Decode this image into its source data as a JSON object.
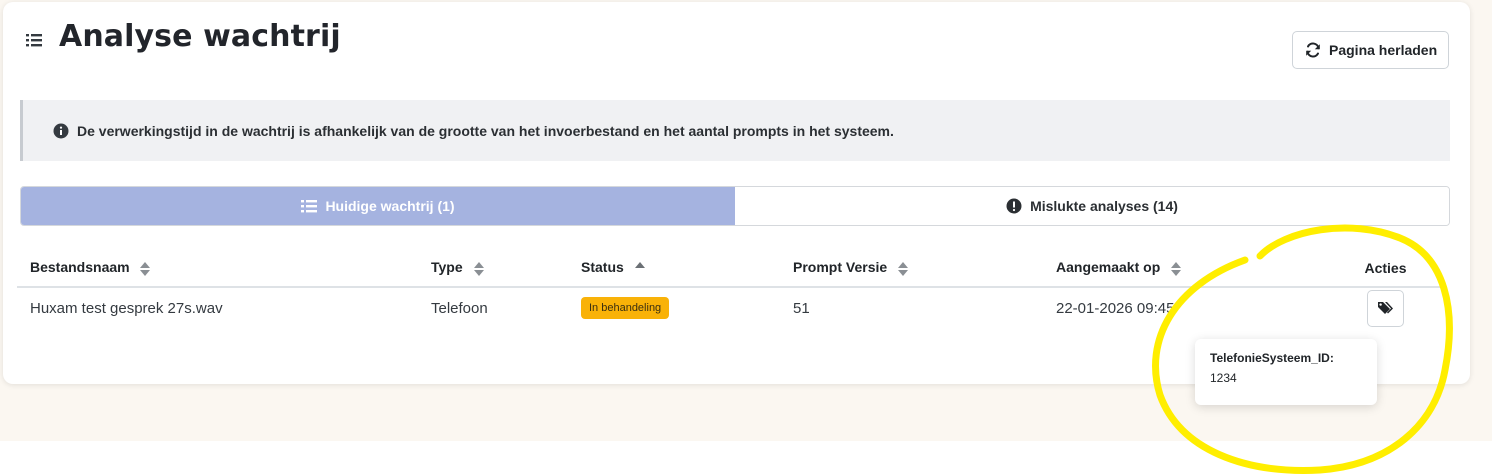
{
  "page": {
    "title": "Analyse wachtrij",
    "menu_icon": "list-icon",
    "reload_button": {
      "label": "Pagina herladen",
      "icon": "refresh-icon"
    }
  },
  "alert": {
    "icon": "info-circle-icon",
    "text": "De verwerkingstijd in de wachtrij is afhankelijk van de grootte van het invoerbestand en het aantal prompts in het systeem."
  },
  "tabs": [
    {
      "label": "Huidige wachtrij (1)",
      "icon": "list-icon",
      "active": true
    },
    {
      "label": "Mislukte analyses (14)",
      "icon": "exclamation-circle-icon",
      "active": false
    }
  ],
  "table": {
    "columns": [
      {
        "label": "Bestandsnaam",
        "sort": "both"
      },
      {
        "label": "Type",
        "sort": "both"
      },
      {
        "label": "Status",
        "sort": "asc"
      },
      {
        "label": "Prompt Versie",
        "sort": "both"
      },
      {
        "label": "Aangemaakt op",
        "sort": "both"
      },
      {
        "label": "Acties",
        "sort": "none"
      }
    ],
    "rows": [
      {
        "filename": "Huxam test gesprek 27s.wav",
        "type": "Telefoon",
        "status": "In behandeling",
        "prompt_version": "51",
        "created": "22-01-2026 09:45",
        "action_icon": "tags-icon"
      }
    ]
  },
  "tooltip": {
    "key": "TelefonieSysteem_ID:",
    "value": "1234"
  },
  "colors": {
    "active_tab": "#a5b3e0",
    "status_badge": "#f9b208",
    "highlight_circle": "#ffee00"
  }
}
